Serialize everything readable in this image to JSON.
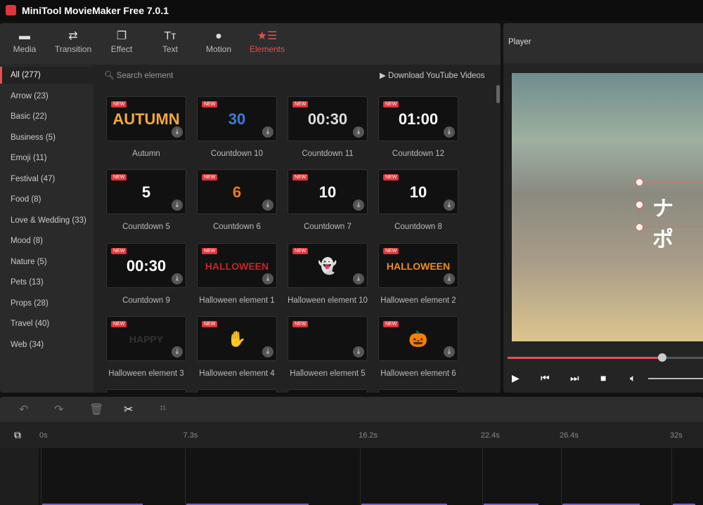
{
  "app": {
    "title": "MiniTool MovieMaker Free 7.0.1",
    "accent": "#ea4e4e"
  },
  "toolbar": {
    "items": [
      {
        "label": "Media",
        "icon": "folder-icon",
        "glyph": "▬"
      },
      {
        "label": "Transition",
        "icon": "swap-arrows-icon",
        "glyph": "⇄"
      },
      {
        "label": "Effect",
        "icon": "layers-icon",
        "glyph": "❐"
      },
      {
        "label": "Text",
        "icon": "text-icon",
        "glyph": "Tт"
      },
      {
        "label": "Motion",
        "icon": "motion-icon",
        "glyph": "●"
      },
      {
        "label": "Elements",
        "icon": "star-list-icon",
        "glyph": "★☰",
        "active": true
      }
    ]
  },
  "sidebar": {
    "items": [
      "All (277)",
      "Arrow (23)",
      "Basic (22)",
      "Business (5)",
      "Emoji (11)",
      "Festival (47)",
      "Food (8)",
      "Love & Wedding (33)",
      "Mood (8)",
      "Nature (5)",
      "Pets (13)",
      "Props (28)",
      "Travel (40)",
      "Web (34)"
    ],
    "active": 0
  },
  "search": {
    "placeholder": "Search element"
  },
  "download_youtube": "Download YouTube Videos",
  "badge_new": "NEW",
  "elements": [
    {
      "label": "Autumn",
      "thumb": "AUTUMN",
      "color": "#f2a93b"
    },
    {
      "label": "Countdown 10",
      "thumb": "30",
      "color": "#3d7be0"
    },
    {
      "label": "Countdown 11",
      "thumb": "00:30",
      "color": "#ddd"
    },
    {
      "label": "Countdown 12",
      "thumb": "01:00",
      "color": "#fff"
    },
    {
      "label": "Countdown 5",
      "thumb": "5",
      "color": "#fff"
    },
    {
      "label": "Countdown 6",
      "thumb": "6",
      "color": "#f07a1a"
    },
    {
      "label": "Countdown 7",
      "thumb": "10",
      "color": "#fff"
    },
    {
      "label": "Countdown 8",
      "thumb": "10",
      "color": "#fff"
    },
    {
      "label": "Countdown 9",
      "thumb": "00:30",
      "color": "#fff"
    },
    {
      "label": "Halloween element 1",
      "thumb": "HALLOWEEN",
      "color": "#c0282b"
    },
    {
      "label": "Halloween element 10",
      "thumb": "👻",
      "color": "#eee"
    },
    {
      "label": "Halloween element 2",
      "thumb": "HALLOWEEN",
      "color": "#e8901e"
    },
    {
      "label": "Halloween element 3",
      "thumb": "HAPPY HALLOWEEN",
      "color": "#333"
    },
    {
      "label": "Halloween element 4",
      "thumb": "✋",
      "color": "#6fa07a"
    },
    {
      "label": "Halloween element 5",
      "thumb": "",
      "color": "#222"
    },
    {
      "label": "Halloween element 6",
      "thumb": "🎃",
      "color": "#f08a1a"
    }
  ],
  "player": {
    "title": "Player",
    "overlay_text": "ナポ",
    "progress": 0.79
  },
  "timeline": {
    "ticks": [
      "0s",
      "7.3s",
      "16.2s",
      "22.4s",
      "26.4s",
      "32s"
    ],
    "clip_color": "#7b5fc4"
  }
}
